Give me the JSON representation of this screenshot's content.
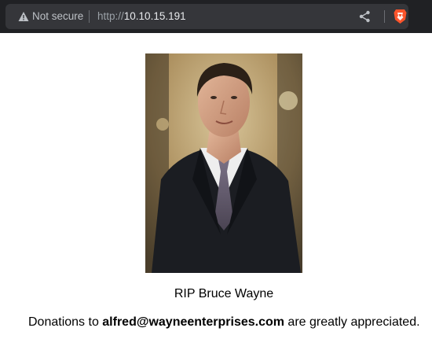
{
  "browser": {
    "security_label": "Not secure",
    "url_scheme": "http://",
    "url_host": "10.10.15.191",
    "icons": [
      "warning-icon",
      "share-icon",
      "brave-shield-icon"
    ]
  },
  "page": {
    "portrait_icon": "portrait-photo",
    "caption": "RIP Bruce Wayne",
    "donations_prefix": "Donations to ",
    "donations_email": "alfred@wayneenterprises.com",
    "donations_suffix": " are greatly appreciated."
  }
}
